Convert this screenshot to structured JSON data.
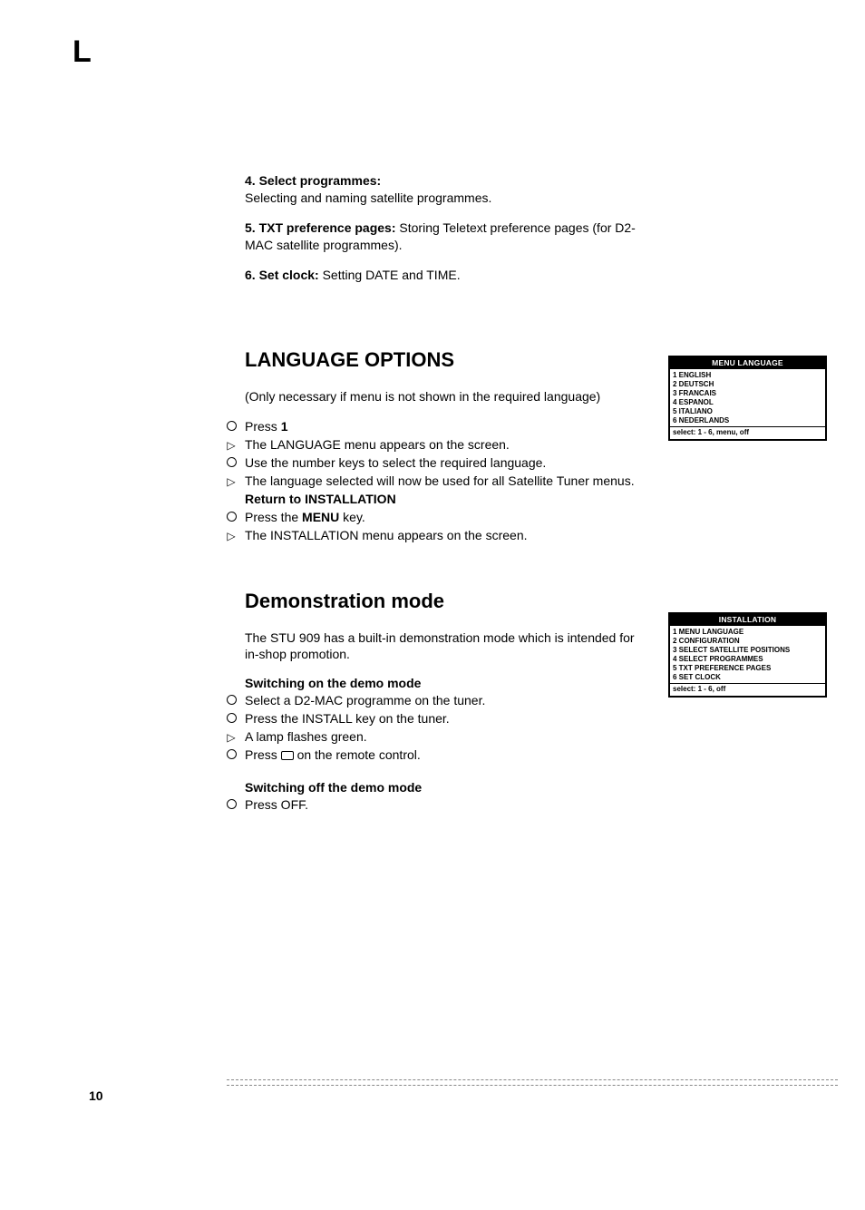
{
  "cornerMark": "L",
  "intro": {
    "item4_title": "4. Select programmes:",
    "item4_body": "Selecting and naming satellite programmes.",
    "item5_title": "5. TXT preference pages:",
    "item5_body": " Storing Teletext preference pages (for D2-MAC satellite programmes).",
    "item6_title": "6. Set clock:",
    "item6_body": " Setting DATE and TIME."
  },
  "lang": {
    "heading": "LANGUAGE OPTIONS",
    "note": "(Only necessary if menu is not shown in the required language)",
    "s1": "Press ",
    "s1_bold": "1",
    "s2a": "The LANGUAGE  menu appears on the screen.",
    "s3": "Use the  number keys to select the required language.",
    "s4": "The language selected will now be used for all Satellite Tuner menus.",
    "returnTitle": "Return to INSTALLATION",
    "s5a": "Press the ",
    "s5b": "MENU",
    "s5c": " key.",
    "s6": "The INSTALLATION menu appears on the screen."
  },
  "demo": {
    "heading": "Demonstration mode",
    "intro": "The STU 909 has a built-in demonstration mode which is intended for in-shop promotion.",
    "onTitle": "Switching on the demo mode",
    "on1": "Select a D2-MAC programme on the tuner.",
    "on2": "Press the INSTALL key on the tuner.",
    "on3": "A lamp flashes green.",
    "on4a": "Press ",
    "on4b": " on the remote control.",
    "offTitle": "Switching off the demo mode",
    "off1": "Press OFF."
  },
  "osd1": {
    "title": "MENU LANGUAGE",
    "items": [
      "1 ENGLISH",
      "2 DEUTSCH",
      "3 FRANCAIS",
      "4 ESPANOL",
      "5 ITALIANO",
      "6 NEDERLANDS"
    ],
    "footer": "select: 1 - 6, menu, off"
  },
  "osd2": {
    "title": "INSTALLATION",
    "items": [
      "1 MENU LANGUAGE",
      "2 CONFIGURATION",
      "3 SELECT SATELLITE POSITIONS",
      "4 SELECT PROGRAMMES",
      "5 TXT PREFERENCE PAGES",
      "6 SET CLOCK"
    ],
    "footer": "select: 1 - 6, off"
  },
  "pageNumber": "10"
}
